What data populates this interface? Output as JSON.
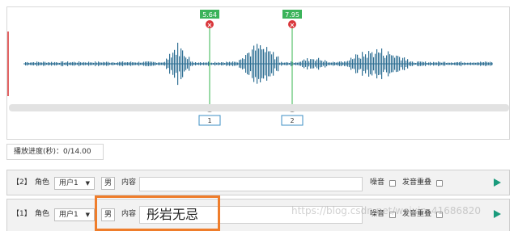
{
  "waveform": {
    "markers": [
      {
        "time_label": "5.64",
        "index_label": "1"
      },
      {
        "time_label": "7.95",
        "index_label": "2"
      }
    ],
    "colors": {
      "wave": "#2e6f93",
      "marker_line": "#56c06b",
      "marker_tag": "#3bb35a",
      "remove_icon": "#d9373b",
      "cursor": "#d93030"
    }
  },
  "playback": {
    "progress_text": "播放进度(秒)：0/14.00"
  },
  "segments": [
    {
      "index_label": "【2】",
      "role_label": "角色",
      "user_value": "用户1",
      "gender": "男",
      "content_label": "内容",
      "content_value": "",
      "noise_label": "噪音",
      "overlap_label": "发音重叠",
      "noise_checked": false,
      "overlap_checked": false
    },
    {
      "index_label": "【1】",
      "role_label": "角色",
      "user_value": "用户1",
      "gender": "男",
      "content_label": "内容",
      "content_value": "彤岩无忌",
      "noise_label": "噪音",
      "overlap_label": "发音重叠",
      "noise_checked": false,
      "overlap_checked": false
    }
  ],
  "watermark": "https://blog.csdn.net/weixin_41686820"
}
